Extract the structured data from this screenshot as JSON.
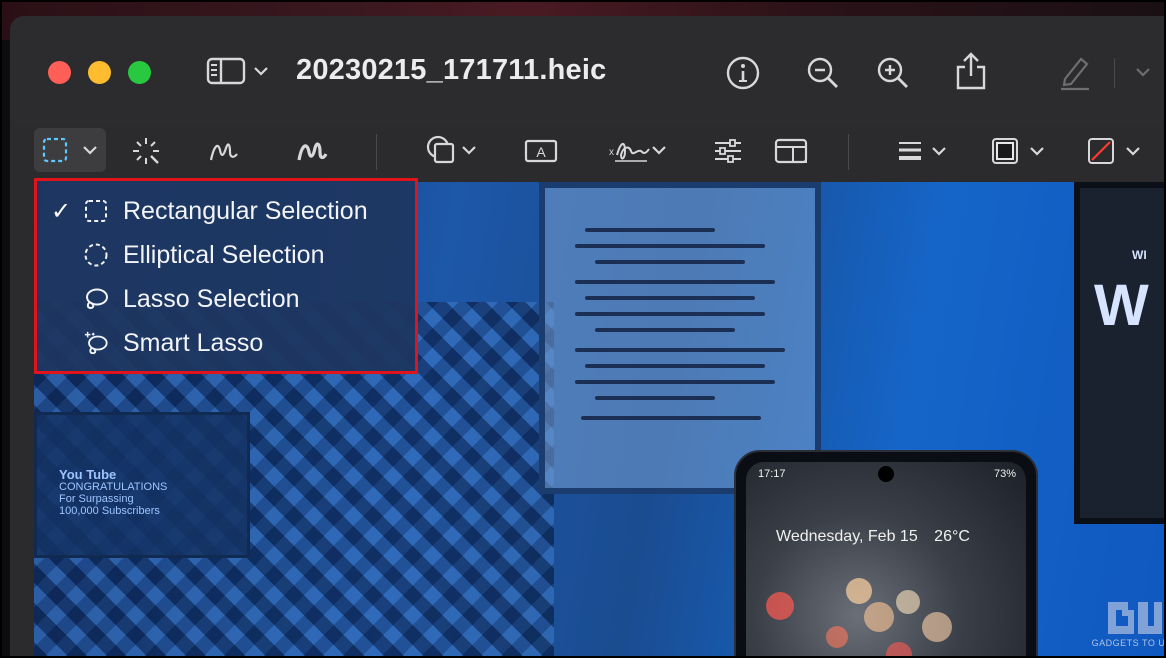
{
  "window": {
    "title": "20230215_171711.heic"
  },
  "titlebar_icons": [
    "sidebar-icon",
    "chevron-down-icon",
    "info-icon",
    "zoom-out-icon",
    "zoom-in-icon",
    "share-icon",
    "markup-pen-icon",
    "chevron-down-icon"
  ],
  "markup_toolbar": {
    "tools": [
      "selection-tool-icon",
      "instant-alpha-icon",
      "sketch-icon",
      "draw-icon",
      "shapes-icon",
      "text-box-icon",
      "sign-icon",
      "adjust-color-icon",
      "adjust-size-icon",
      "shape-style-icon",
      "border-color-icon",
      "fill-color-icon"
    ]
  },
  "selection_menu": {
    "items": [
      {
        "label": "Rectangular Selection",
        "checked": true,
        "icon": "rectangle-selection-icon"
      },
      {
        "label": "Elliptical Selection",
        "checked": false,
        "icon": "ellipse-selection-icon"
      },
      {
        "label": "Lasso Selection",
        "checked": false,
        "icon": "lasso-icon"
      },
      {
        "label": "Smart Lasso",
        "checked": false,
        "icon": "smart-lasso-icon"
      }
    ],
    "checkmark": "✓",
    "highlight_color": "#e0141a"
  },
  "image_content": {
    "plaque_title": "You Tube",
    "plaque_line1": "CONGRATULATIONS",
    "plaque_line2": "For Surpassing",
    "plaque_line3": "100,000 Subscribers",
    "phone_time": "17:17",
    "phone_battery": "73%",
    "phone_date": "Wednesday, Feb 15",
    "phone_temp": "26°C",
    "frame_text_large": "W",
    "frame_text_small": "WI"
  },
  "watermark": {
    "text": "GADGETS TO USE"
  }
}
